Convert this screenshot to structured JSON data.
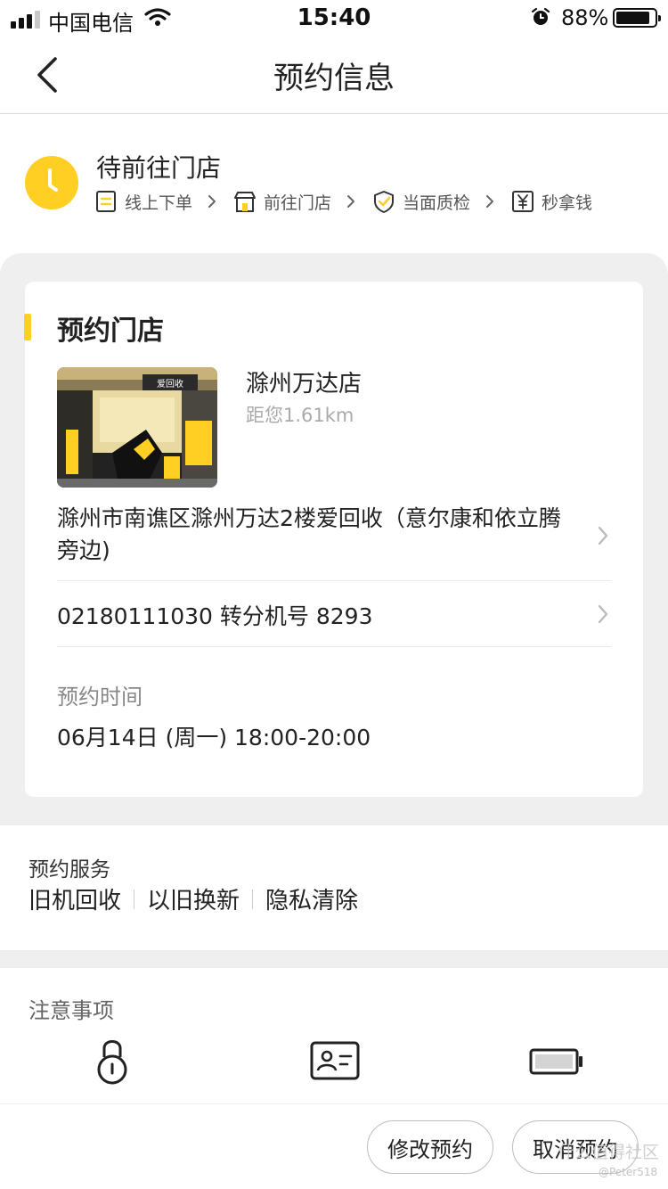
{
  "status_bar": {
    "carrier": "中国电信",
    "time": "15:40",
    "battery": "88%",
    "battery_level": 0.88
  },
  "nav": {
    "title": "预约信息",
    "back_icon": "chevron-left-icon"
  },
  "order_status": {
    "title": "待前往门店",
    "status_icon": "clock-icon",
    "steps": [
      {
        "label": "线上下单",
        "icon": "form-icon"
      },
      {
        "label": "前往门店",
        "icon": "store-icon"
      },
      {
        "label": "当面质检",
        "icon": "shield-check-icon"
      },
      {
        "label": "秒拿钱",
        "icon": "yuan-icon"
      }
    ]
  },
  "store_card": {
    "title": "预约门店",
    "store_name": "滁州万达店",
    "distance": "距您1.61km",
    "photo_sign": "爱回收",
    "address": "滁州市南谯区滁州万达2楼爱回收（意尔康和依立腾旁边)",
    "phone": "02180111030 转分机号 8293",
    "time_label": "预约时间",
    "time_value": "06月14日 (周一) 18:00-20:00"
  },
  "services": {
    "label": "预约服务",
    "items": [
      "旧机回收",
      "以旧换新",
      "隐私清除"
    ]
  },
  "notes": {
    "label": "注意事项",
    "icons": [
      "lock-icon",
      "id-card-icon",
      "battery-icon"
    ]
  },
  "actions": {
    "modify": "修改预约",
    "cancel": "取消预约"
  },
  "watermark": {
    "text": "什么值得社区",
    "sub": "@Peter518"
  },
  "colors": {
    "accent": "#ffcf24",
    "backdrop": "#efefef",
    "muted_text": "#aaaaaa"
  }
}
